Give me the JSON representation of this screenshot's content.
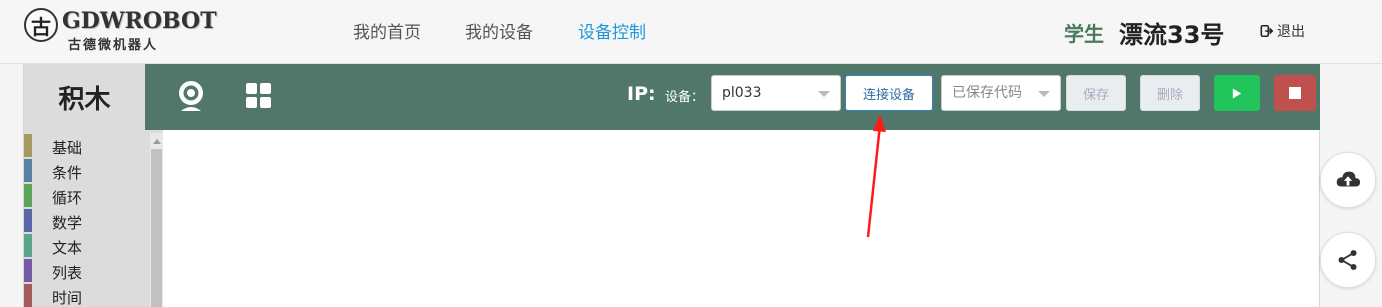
{
  "header": {
    "logo": {
      "badge_char": "古",
      "name": "GDWROBOT",
      "subtitle": "古德微机器人"
    },
    "nav": [
      {
        "label": "我的首页"
      },
      {
        "label": "我的设备"
      },
      {
        "label": "设备控制",
        "active": true
      }
    ],
    "user": {
      "role": "学生",
      "name": "漂流33号"
    },
    "logout_label": "退出"
  },
  "blocks_title": "积木",
  "toolbar": {
    "icons": [
      "webcam-icon",
      "grid-icon"
    ],
    "ip_label": "IP:",
    "device_label": "设备：",
    "device_select_value": "pl033",
    "connect_label": "连接设备",
    "saved_code_select_value": "已保存代码",
    "save_label": "保存",
    "delete_label": "删除",
    "run_icon": "play-icon",
    "stop_icon": "stop-icon"
  },
  "categories": [
    {
      "label": "基础",
      "color": "#a59a5f"
    },
    {
      "label": "条件",
      "color": "#5b80a5"
    },
    {
      "label": "循环",
      "color": "#5ba55b"
    },
    {
      "label": "数学",
      "color": "#5b67a5"
    },
    {
      "label": "文本",
      "color": "#5ba58c"
    },
    {
      "label": "列表",
      "color": "#745ba5"
    },
    {
      "label": "时间",
      "color": "#a55b5b"
    }
  ],
  "float_buttons": [
    "cloud-upload-icon",
    "share-icon"
  ],
  "colors": {
    "toolbar_bg": "#51776a",
    "nav_active": "#2196d9",
    "run": "#21c45b",
    "stop": "#c0504d",
    "annotation_arrow": "#ff1a1a"
  }
}
